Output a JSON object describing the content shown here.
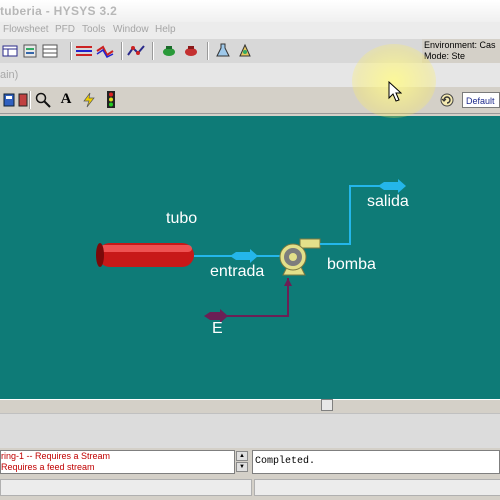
{
  "window": {
    "title": "tuberia - HYSYS 3.2"
  },
  "menu": [
    "Flowsheet",
    "PFD",
    "Tools",
    "Window",
    "Help"
  ],
  "environment": {
    "line1": "Environment: Cas",
    "line2": "Mode: Ste"
  },
  "subwindow_title": "ain)",
  "toolbar2": {
    "default_label": "Default"
  },
  "pfd": {
    "labels": {
      "tubo": "tubo",
      "entrada": "entrada",
      "bomba": "bomba",
      "salida": "salida",
      "E": "E"
    },
    "colors": {
      "background": "#0e7b77",
      "material_stream": "#24b6ea",
      "energy_stream": "#6b1f55",
      "pipe": "#d21414"
    }
  },
  "messages": [
    "ring-1 -- Requires a Stream",
    "Requires a feed stream"
  ],
  "status": "Completed."
}
